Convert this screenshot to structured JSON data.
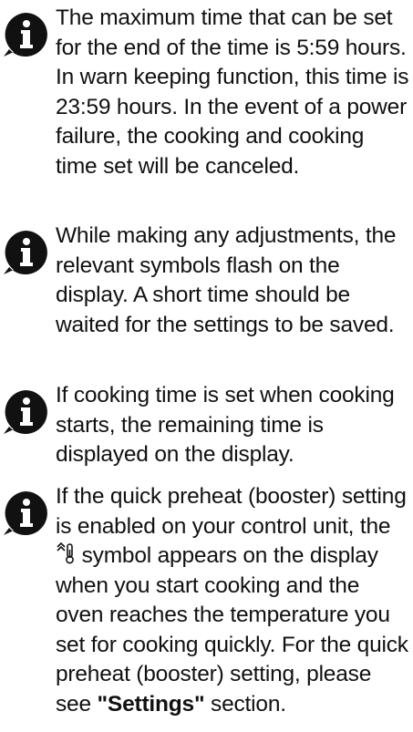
{
  "notes": [
    {
      "icon": "info-icon",
      "text": "The maximum time that can be set for the end of the time is 5:59 hours. In warn keeping function, this time is 23:59 hours. In the event of a power failure, the cooking and cooking time set will be canceled."
    },
    {
      "icon": "info-icon",
      "text": "While making any adjustments, the relevant symbols flash on the display. A short time should be waited for the settings to be saved."
    },
    {
      "icon": "info-icon",
      "text": "If cooking time is set when cooking starts, the remaining time is displayed on the display."
    },
    {
      "icon": "info-icon",
      "text_before": "If the quick preheat (booster) setting is enabled on your control unit, the",
      "symbol": "booster-symbol-icon",
      "text_after": "symbol appears on the display when you start cooking and the oven reaches the temperature you set for cooking quickly. For the quick preheat (booster) setting, please see",
      "link": "\"Settings\"",
      "text_end": "section."
    }
  ]
}
